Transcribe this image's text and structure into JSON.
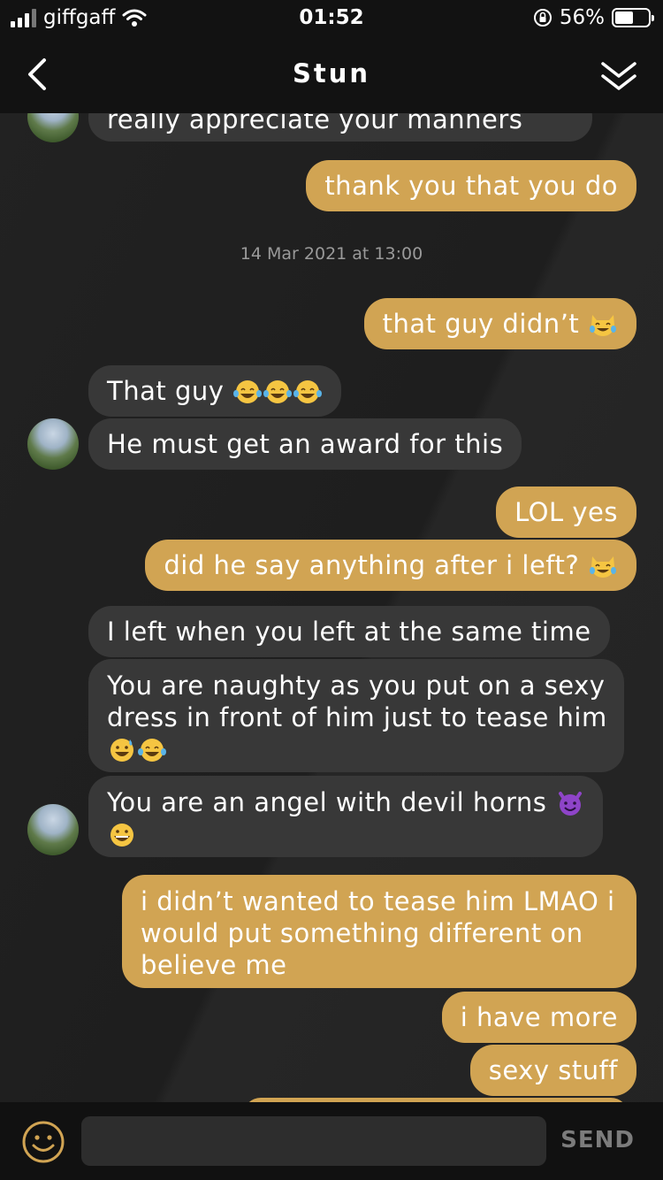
{
  "status_bar": {
    "carrier": "giffgaff",
    "time": "01:52",
    "battery_percent": "56%",
    "battery_level": 0.56
  },
  "header": {
    "title": "Stun",
    "back_icon": "chevron-left-icon",
    "collapse_icon": "double-chevron-down-icon"
  },
  "chat": {
    "messages": [
      {
        "side": "in",
        "text": "really appreciate your manners"
      },
      {
        "side": "out",
        "text": "thank you that you do"
      },
      {
        "type": "timestamp",
        "text": "14 Mar 2021 at 13:00"
      },
      {
        "side": "out",
        "text": "that guy didn’t",
        "emoji": [
          "tears-of-joy-cat"
        ]
      },
      {
        "side": "in",
        "text": "That guy",
        "emoji": [
          "tears-of-joy",
          "tears-of-joy",
          "tears-of-joy"
        ]
      },
      {
        "side": "in",
        "text": "He must get an award for this"
      },
      {
        "side": "out",
        "text": "LOL yes"
      },
      {
        "side": "out",
        "text": "did he say anything after i left?",
        "emoji": [
          "tears-of-joy-cat"
        ]
      },
      {
        "side": "in",
        "text": "I left when you left at the same time"
      },
      {
        "side": "in",
        "line1": "You are naughty as you put on a sexy",
        "line2": "dress in front of him just to tease him",
        "emoji": [
          "grinning-sweat",
          "tears-of-joy"
        ]
      },
      {
        "side": "in",
        "line1": "You are an angel with devil horns",
        "emoji": [
          "smiling-devil",
          "grinning"
        ]
      },
      {
        "side": "out",
        "line1": "i didn’t wanted to tease him LMAO i",
        "line2": "would put something different on",
        "line3": "believe me"
      },
      {
        "side": "out",
        "text": "i have more"
      },
      {
        "side": "out",
        "text": "sexy stuff"
      }
    ]
  },
  "composer": {
    "emoji_icon": "smiley-icon",
    "input_value": "",
    "send_label": "SEND"
  },
  "colors": {
    "outgoing": "#d1a453",
    "incoming": "#383838",
    "background": "#1c1c1c"
  }
}
